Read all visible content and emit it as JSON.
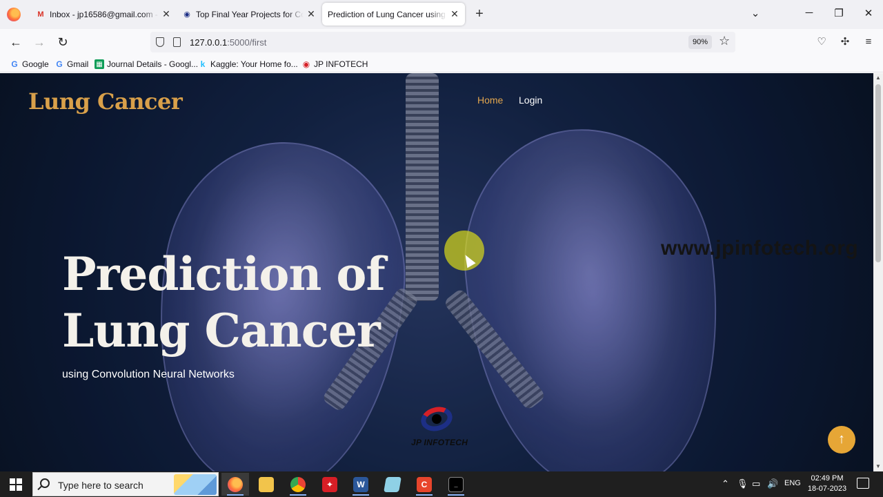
{
  "browser": {
    "tabs": [
      {
        "title": "Inbox - jp16586@gmail.com - G",
        "favicon": "gmail-icon",
        "active": false
      },
      {
        "title": "Top Final Year Projects for Com",
        "favicon": "jp-infotech-icon",
        "active": false
      },
      {
        "title": "Prediction of Lung Cancer using Co",
        "favicon": "none",
        "active": true
      }
    ],
    "new_tab": "+",
    "url_host": "127.0.0.1",
    "url_path": ":5000/first",
    "zoom": "90%",
    "bookmarks": [
      {
        "label": "Google",
        "icon": "google-icon"
      },
      {
        "label": "Gmail",
        "icon": "google-icon"
      },
      {
        "label": "Journal Details - Googl...",
        "icon": "sheets-icon"
      },
      {
        "label": "Kaggle: Your Home fo...",
        "icon": "kaggle-icon"
      },
      {
        "label": "JP INFOTECH",
        "icon": "jp-infotech-icon"
      }
    ]
  },
  "page": {
    "brand": "Lung Cancer",
    "nav": {
      "home": "Home",
      "login": "Login"
    },
    "hero_title": "Prediction of Lung Cancer",
    "hero_subtitle": "using Convolution Neural Networks",
    "watermark": "www.jpinfotech.org",
    "logo_text": "JP INFOTECH",
    "accent_color": "#e6a636",
    "brand_color": "#d9a04a"
  },
  "taskbar": {
    "search_placeholder": "Type here to search",
    "language": "ENG",
    "time": "02:49 PM",
    "date": "18-07-2023"
  }
}
